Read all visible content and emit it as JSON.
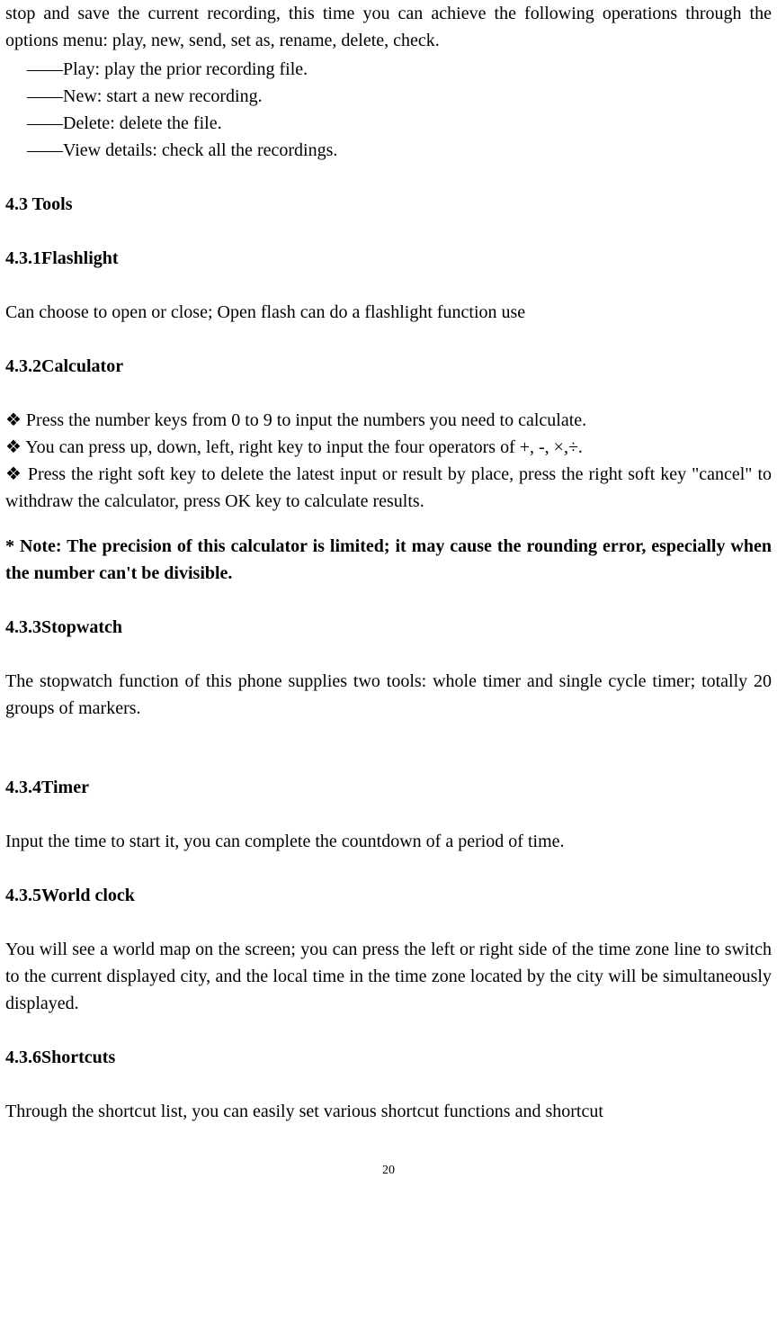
{
  "intro_para": "stop and save the current recording, this time you can achieve the following operations through the options menu: play, new, send, set as, rename, delete, check.",
  "bullets": [
    "——Play: play the prior recording file.",
    "——New: start a new recording.",
    "——Delete: delete the file.",
    "——View details: check all the recordings."
  ],
  "h43": "4.3 Tools",
  "h431": "4.3.1Flashlight",
  "p431": "Can choose to open or close; Open flash can do a flashlight function use",
  "h432": "4.3.2Calculator",
  "calc_lines": [
    "❖  Press the number keys from 0 to 9 to input the numbers you need to calculate.",
    "❖  You can press up, down, left, right key to input the four operators of +, -, ×,÷.",
    "❖  Press the right soft key to delete the latest input or result by place, press the right soft key \"cancel\" to withdraw the calculator, press OK key to calculate results."
  ],
  "calc_note": "*  Note: The precision of this calculator is limited; it may cause the rounding error, especially when the number can't be divisible.",
  "h433": "4.3.3Stopwatch",
  "p433": "The stopwatch function of this phone supplies two tools: whole timer and single cycle timer; totally 20 groups of markers.",
  "h434": "4.3.4Timer",
  "p434": "Input the time to start it, you can complete the countdown of a period of time.",
  "h435": "4.3.5World clock",
  "p435": "You will see a world map on the screen; you can press the left or right side of the time zone line to switch to the current displayed city, and the local time in the time zone located by the city will be simultaneously displayed.",
  "h436": "4.3.6Shortcuts",
  "p436": "Through the shortcut list, you can easily set various shortcut functions and shortcut",
  "page_number": "20"
}
